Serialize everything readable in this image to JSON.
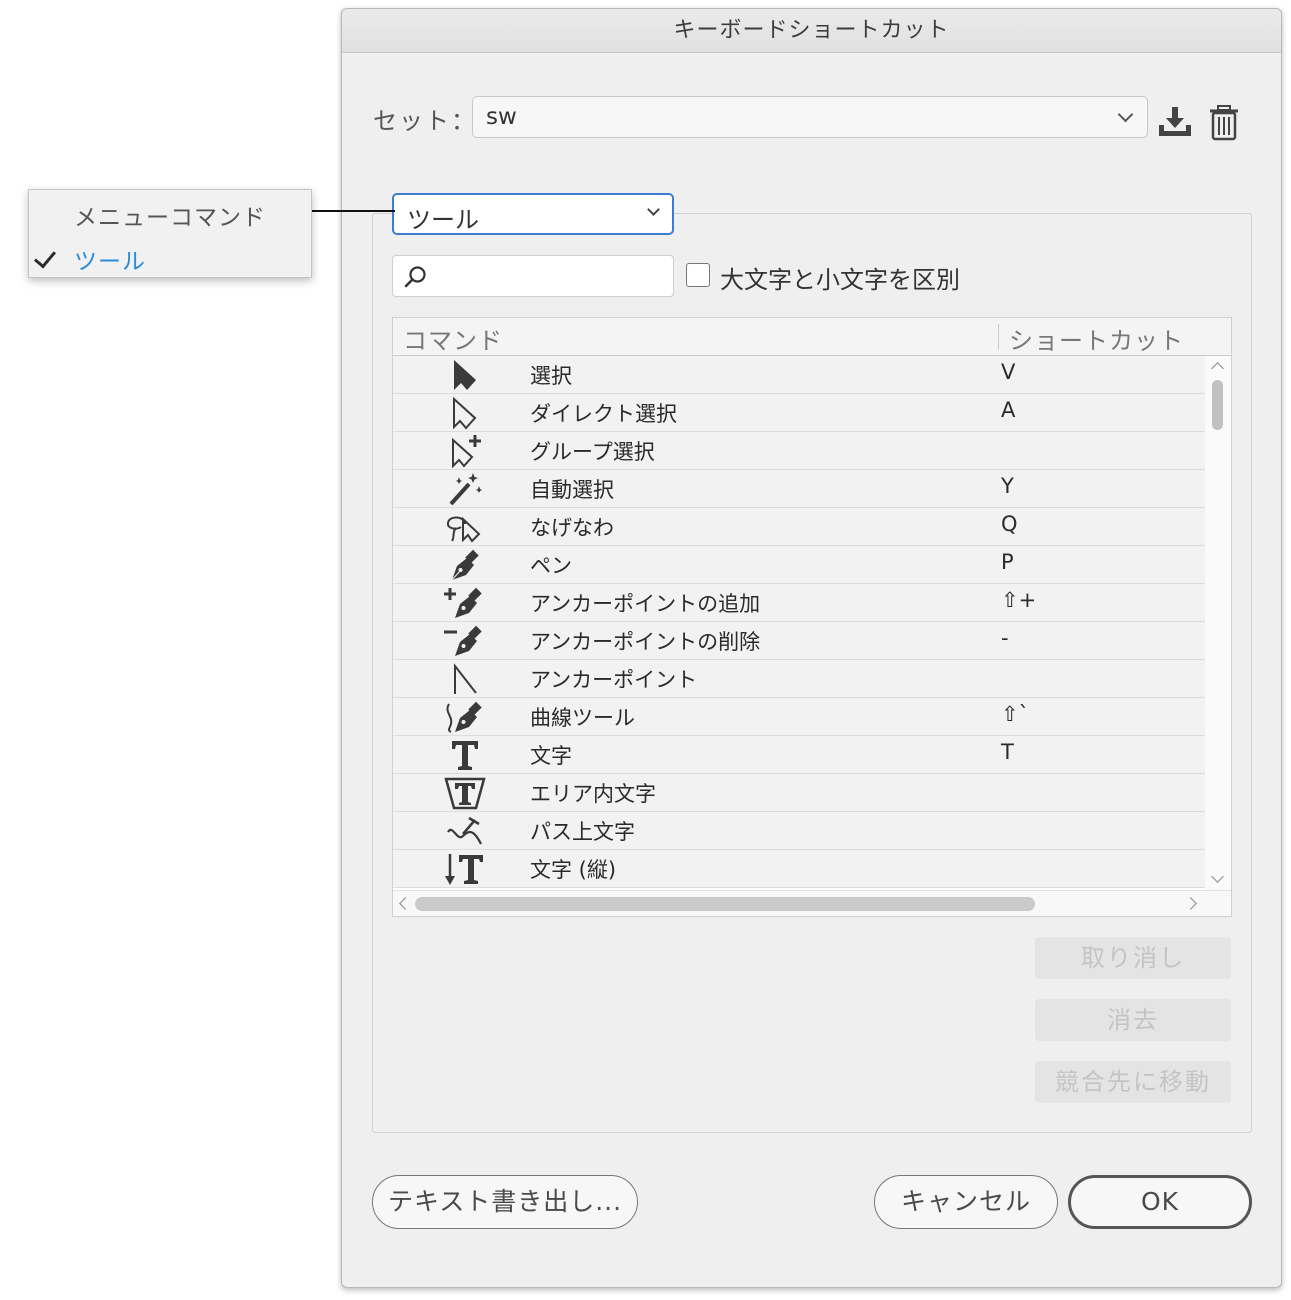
{
  "dialog": {
    "title": "キーボードショートカット",
    "set_label": "セット：",
    "set_value": "sw",
    "category_value": "ツール",
    "case_label": "大文字と小文字を区別",
    "search_placeholder": "",
    "columns": {
      "command": "コマンド",
      "shortcut": "ショートカット"
    },
    "rows": [
      {
        "icon": "selection-arrow-icon",
        "name": "選択",
        "key": "V"
      },
      {
        "icon": "direct-selection-icon",
        "name": "ダイレクト選択",
        "key": "A"
      },
      {
        "icon": "group-selection-icon",
        "name": "グループ選択",
        "key": ""
      },
      {
        "icon": "magic-wand-icon",
        "name": "自動選択",
        "key": "Y"
      },
      {
        "icon": "lasso-icon",
        "name": "なげなわ",
        "key": "Q"
      },
      {
        "icon": "pen-icon",
        "name": "ペン",
        "key": "P"
      },
      {
        "icon": "add-anchor-point-icon",
        "name": "アンカーポイントの追加",
        "key": "⇧+"
      },
      {
        "icon": "delete-anchor-point-icon",
        "name": "アンカーポイントの削除",
        "key": "-"
      },
      {
        "icon": "anchor-point-icon",
        "name": "アンカーポイント",
        "key": ""
      },
      {
        "icon": "curvature-icon",
        "name": "曲線ツール",
        "key": "⇧`"
      },
      {
        "icon": "type-icon",
        "name": "文字",
        "key": "T"
      },
      {
        "icon": "area-type-icon",
        "name": "エリア内文字",
        "key": ""
      },
      {
        "icon": "type-on-path-icon",
        "name": "パス上文字",
        "key": ""
      },
      {
        "icon": "vertical-type-icon",
        "name": "文字 (縦)",
        "key": ""
      }
    ],
    "buttons": {
      "undo": "取り消し",
      "clear": "消去",
      "goto_conflict": "競合先に移動",
      "export_text": "テキスト書き出し...",
      "cancel": "キャンセル",
      "ok": "OK"
    }
  },
  "dropdown_menu": {
    "items": [
      {
        "label": "メニューコマンド",
        "checked": false
      },
      {
        "label": "ツール",
        "checked": true
      }
    ],
    "selected_color": "#2a8bd8"
  },
  "colors": {
    "focus_ring": "#3e7bd3",
    "accent": "#2a8bd8"
  }
}
